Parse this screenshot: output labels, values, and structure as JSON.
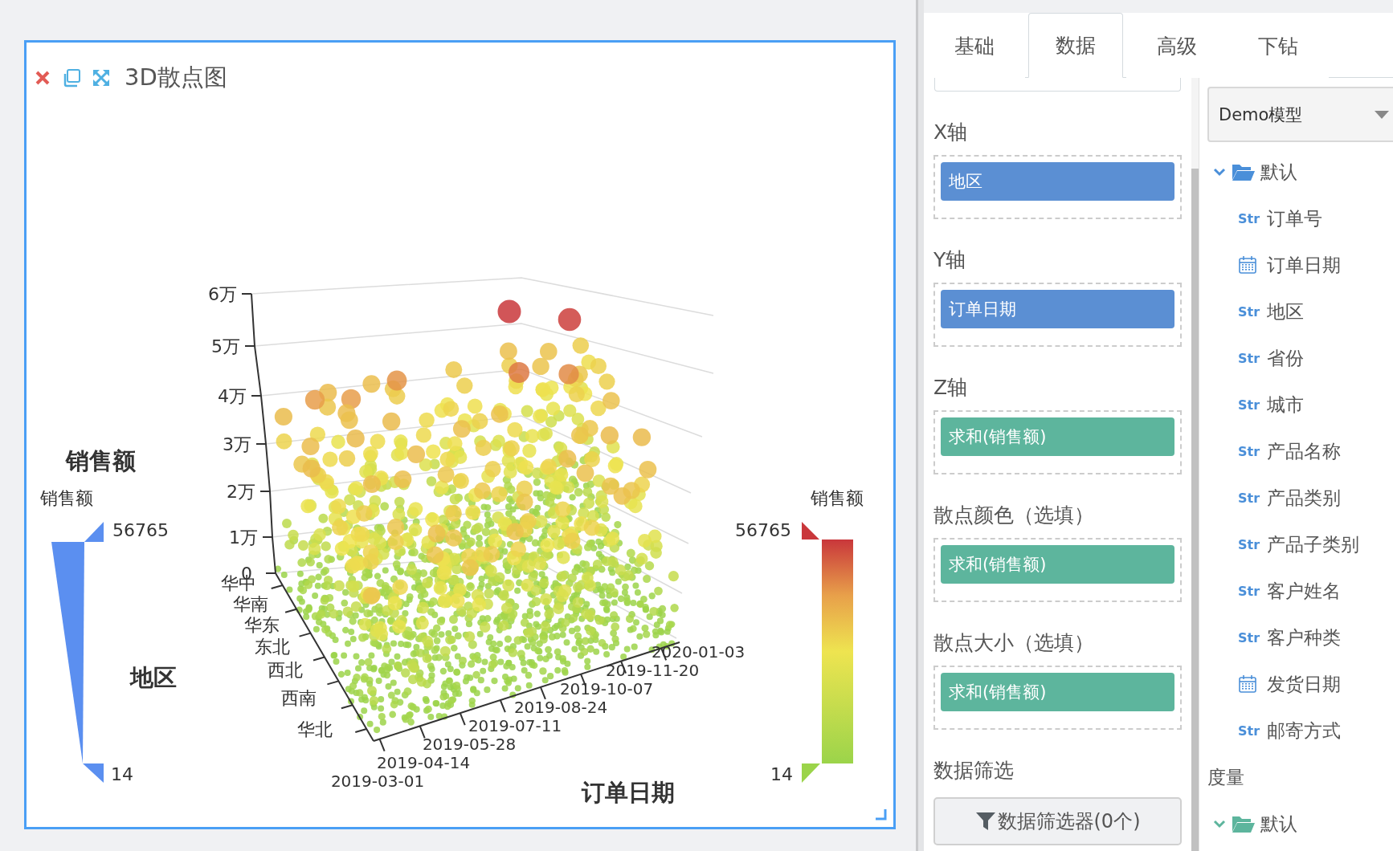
{
  "chart_card": {
    "title": "3D散点图",
    "z_axis": {
      "name": "销售额",
      "ticks": [
        "6万",
        "5万",
        "4万",
        "3万",
        "2万",
        "1万",
        "0"
      ]
    },
    "x_axis": {
      "name": "地区",
      "ticks": [
        "华中",
        "华南",
        "华东",
        "东北",
        "西北",
        "西南",
        "华北"
      ]
    },
    "y_axis": {
      "name": "订单日期",
      "ticks": [
        "2020-01-03",
        "2019-11-20",
        "2019-10-07",
        "2019-08-24",
        "2019-07-11",
        "2019-05-28",
        "2019-04-14",
        "2019-03-01"
      ]
    },
    "size_legend": {
      "title": "销售额",
      "max": "56765",
      "min": "14"
    },
    "color_legend": {
      "title": "销售额",
      "max": "56765",
      "min": "14"
    }
  },
  "panel": {
    "tabs": [
      {
        "label": "基础",
        "selected": false
      },
      {
        "label": "数据",
        "selected": true
      },
      {
        "label": "高级",
        "selected": false
      },
      {
        "label": "下钻",
        "selected": false
      }
    ],
    "sections": [
      {
        "label": "X轴",
        "pill": {
          "kind": "dimension",
          "text": "地区"
        }
      },
      {
        "label": "Y轴",
        "pill": {
          "kind": "dimension",
          "text": "订单日期"
        }
      },
      {
        "label": "Z轴",
        "pill": {
          "kind": "measure",
          "text": "求和(销售额)"
        }
      },
      {
        "label": "散点颜色（选填）",
        "pill": {
          "kind": "measure",
          "text": "求和(销售额)"
        }
      },
      {
        "label": "散点大小（选填）",
        "pill": {
          "kind": "measure",
          "text": "求和(销售额)"
        }
      }
    ],
    "filter": {
      "label": "数据筛选",
      "button": "数据筛选器(0个)"
    },
    "model_select": {
      "value": "Demo模型"
    },
    "field_groups": [
      {
        "kind": "dimension",
        "folder": {
          "label": "默认",
          "expanded": true,
          "children": [
            {
              "kind": "text",
              "badge": "Str",
              "label": "订单号"
            },
            {
              "kind": "date",
              "label": "订单日期"
            },
            {
              "kind": "text",
              "badge": "Str",
              "label": "地区"
            },
            {
              "kind": "text",
              "badge": "Str",
              "label": "省份"
            },
            {
              "kind": "text",
              "badge": "Str",
              "label": "城市"
            },
            {
              "kind": "text",
              "badge": "Str",
              "label": "产品名称"
            },
            {
              "kind": "text",
              "badge": "Str",
              "label": "产品类别"
            },
            {
              "kind": "text",
              "badge": "Str",
              "label": "产品子类别"
            },
            {
              "kind": "text",
              "badge": "Str",
              "label": "客户姓名"
            },
            {
              "kind": "text",
              "badge": "Str",
              "label": "客户种类"
            },
            {
              "kind": "date",
              "label": "发货日期"
            },
            {
              "kind": "text",
              "badge": "Str",
              "label": "邮寄方式"
            }
          ]
        }
      },
      {
        "kind": "measure",
        "heading": "度量",
        "folder": {
          "label": "默认",
          "expanded": true
        }
      }
    ]
  }
}
